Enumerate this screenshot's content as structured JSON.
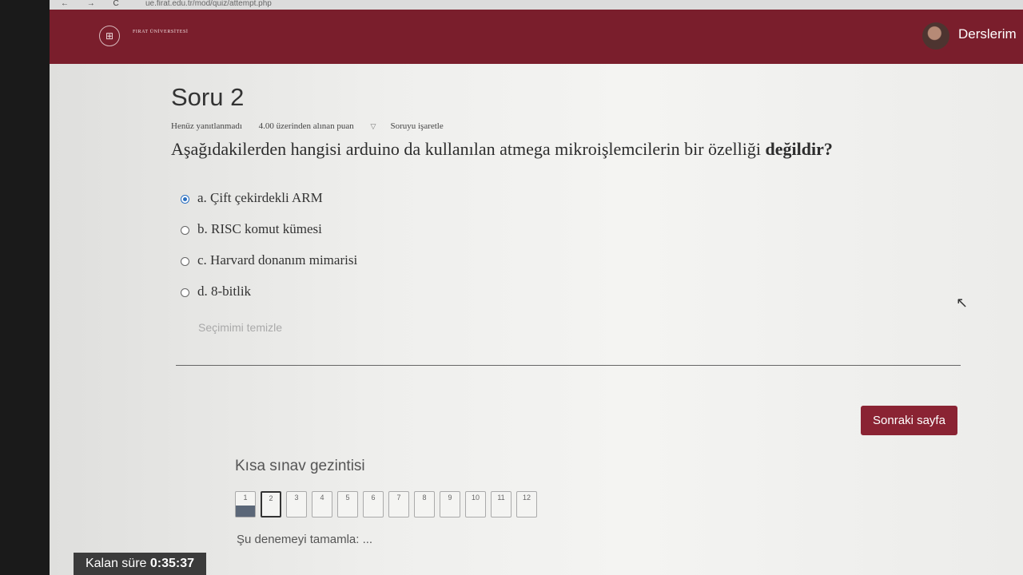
{
  "browser": {
    "nav_icons": "← → C",
    "url": "ue.firat.edu.tr/mod/quiz/attempt.php"
  },
  "header": {
    "logo_text": "FIRAT ÜNİVERSİTESİ",
    "logo_icon": "university-seal-icon",
    "user_menu_label": "Derslerim"
  },
  "question": {
    "title": "Soru 2",
    "status": "Henüz yanıtlanmadı",
    "points": "4.00 üzerinden alınan puan",
    "flag_label": "Soruyu işaretle",
    "text_prefix": "Aşağıdakilerden hangisi arduino da kullanılan atmega mikroişlemcilerin bir özelliği ",
    "text_emphasis": "değildir",
    "text_suffix": "?",
    "answers": [
      {
        "label": "a. Çift çekirdekli ARM",
        "selected": true
      },
      {
        "label": "b. RISC komut kümesi",
        "selected": false
      },
      {
        "label": "c. Harvard donanım mimarisi",
        "selected": false
      },
      {
        "label": "d. 8-bitlik",
        "selected": false
      }
    ],
    "clear_label": "Seçimimi temizle"
  },
  "next_button_label": "Sonraki sayfa",
  "quiz_nav": {
    "title": "Kısa sınav gezintisi",
    "buttons": [
      "1",
      "2",
      "3",
      "4",
      "5",
      "6",
      "7",
      "8",
      "9",
      "10",
      "11",
      "12"
    ],
    "answered": [
      1
    ],
    "current": 2,
    "finish_label": "Şu denemeyi tamamla: ..."
  },
  "timer": {
    "label": "Kalan süre",
    "value": "0:35:37"
  },
  "colors": {
    "brand": "#7a1e2c",
    "button": "#8a2333",
    "radio_selected": "#2a6fc0"
  }
}
